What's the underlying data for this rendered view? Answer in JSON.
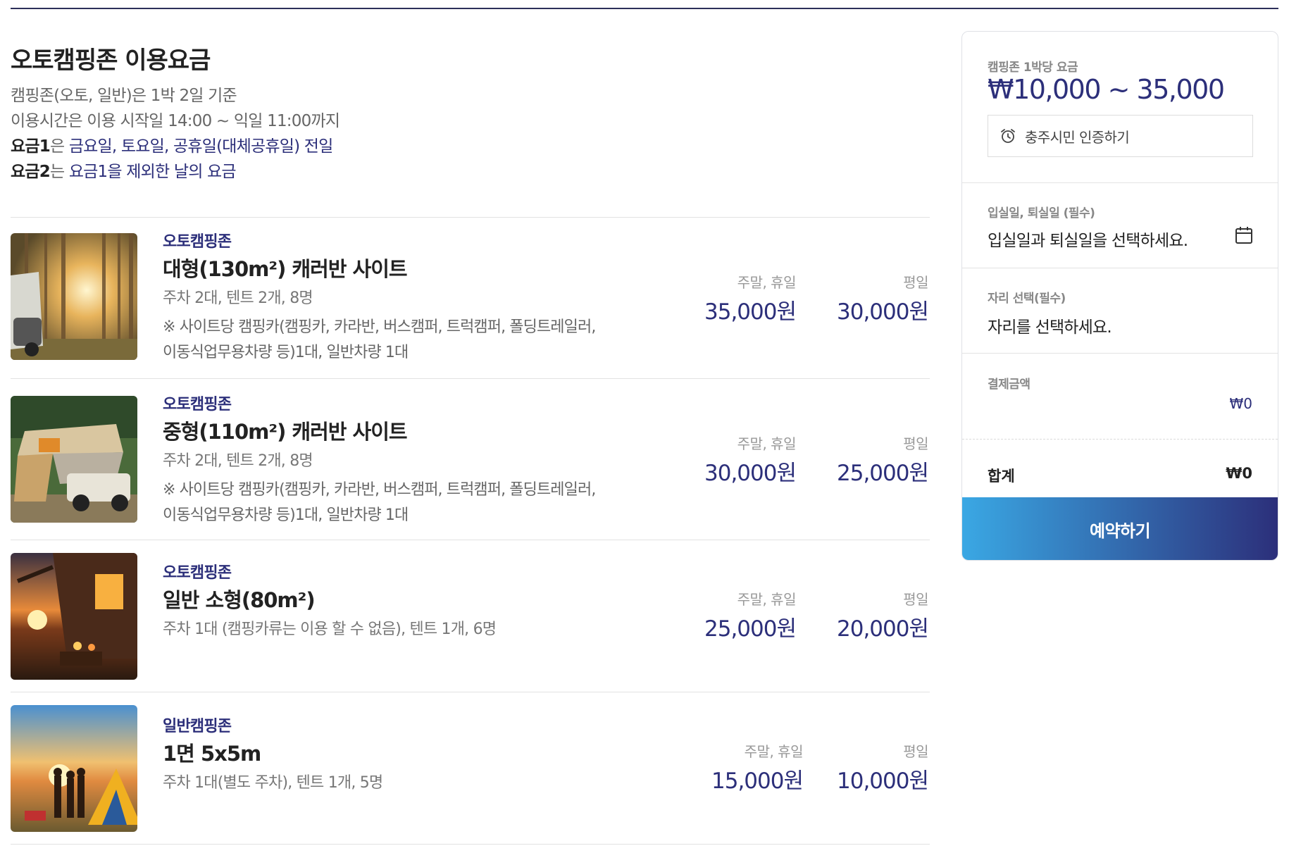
{
  "colors": {
    "accent": "#2c2f7a",
    "button_gradient_start": "#3aa8e4",
    "button_gradient_end": "#2c2f7a"
  },
  "page": {
    "title": "오토캠핑존 이용요금",
    "intro": {
      "line1": "캠핑존(오토, 일반)은 1박 2일 기준",
      "line2": "이용시간은 이용 시작일 14:00 ~ 익일 11:00까지",
      "line3_label": "요금1",
      "line3_particle": "은 ",
      "line3_desc": "금요일, 토요일, 공휴일(대체공휴일) 전일",
      "line4_label": "요금2",
      "line4_particle": "는 ",
      "line4_desc": "요금1을 제외한 날의 요금"
    }
  },
  "sites": [
    {
      "category": "오토캠핑존",
      "name": "대형(130m²) 캐러반 사이트",
      "capacity": "주차 2대, 텐트 2개, 8명",
      "note_line1": "※ 사이트당 캠핑카(캠핑카, 카라반, 버스캠퍼, 트럭캠퍼, 폴딩트레일러,",
      "note_line2": "이동식업무용차량 등)1대, 일반차량 1대",
      "weekend_label": "주말, 휴일",
      "weekend_price": "35,000원",
      "weekday_label": "평일",
      "weekday_price": "30,000원",
      "image": "caravan-in-forest-photo"
    },
    {
      "category": "오토캠핑존",
      "name": "중형(110m²) 캐러반 사이트",
      "capacity": "주차 2대, 텐트 2개, 8명",
      "note_line1": "※ 사이트당 캠핑카(캠핑카, 카라반, 버스캠퍼, 트럭캠퍼, 폴딩트레일러,",
      "note_line2": "이동식업무용차량 등)1대, 일반차량 1대",
      "weekend_label": "주말, 휴일",
      "weekend_price": "30,000원",
      "weekday_label": "평일",
      "weekday_price": "25,000원",
      "image": "rooftop-tent-car-photo"
    },
    {
      "category": "오토캠핑존",
      "name": "일반 소형(80m²)",
      "capacity": "주차 1대 (캠핑카류는 이용 할 수 없음), 텐트 1개, 6명",
      "weekend_label": "주말, 휴일",
      "weekend_price": "25,000원",
      "weekday_label": "평일",
      "weekday_price": "20,000원",
      "image": "sunset-campsite-lanterns-photo"
    },
    {
      "category": "일반캠핑존",
      "name": "1면 5x5m",
      "capacity": "주차 1대(별도 주차), 텐트 1개, 5명",
      "weekend_label": "주말, 휴일",
      "weekend_price": "15,000원",
      "weekday_label": "평일",
      "weekday_price": "10,000원",
      "image": "friends-tent-sunset-photo"
    }
  ],
  "sidebar": {
    "rate_label": "캠핑존 1박당 요금",
    "rate_range": "₩10,000 ~ 35,000",
    "cert_icon": "alarm-clock-icon",
    "cert_button": "충주시민 인증하기",
    "dates_label": "입실일, 퇴실일 (필수)",
    "dates_value": "입실일과 퇴실일을 선택하세요.",
    "dates_icon": "calendar-icon",
    "site_label": "자리 선택(필수)",
    "site_value": "자리를 선택하세요.",
    "payment_label": "결제금액",
    "payment_amount": "₩0",
    "total_label": "합계",
    "total_amount": "₩0",
    "reserve_button": "예약하기"
  }
}
